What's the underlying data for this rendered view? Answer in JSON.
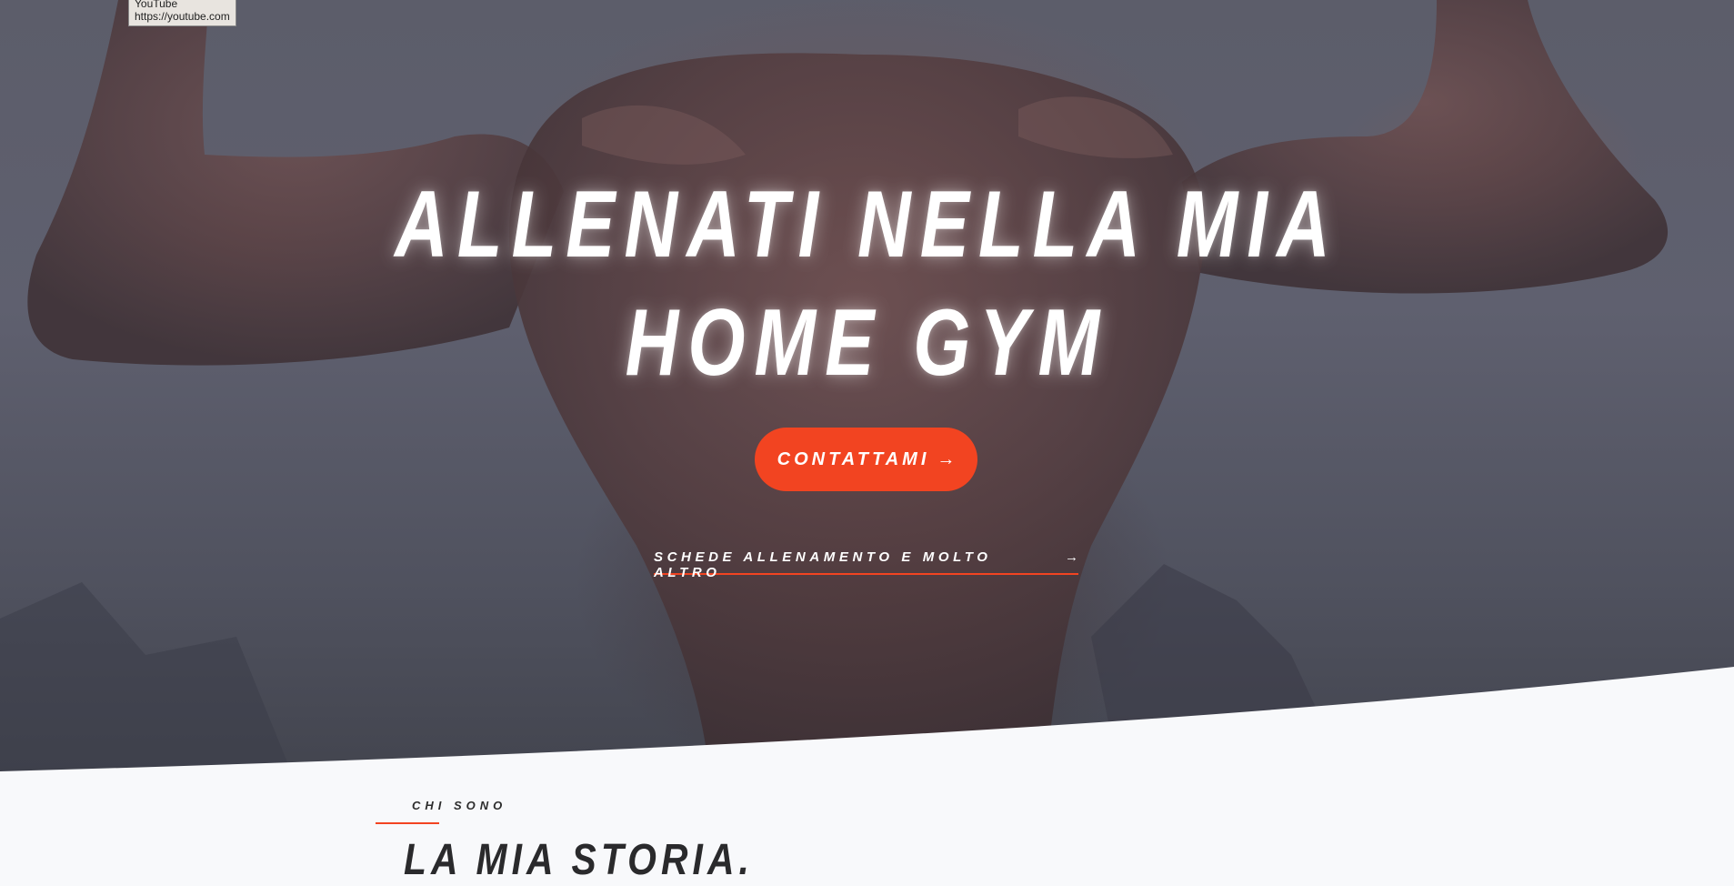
{
  "tooltip": {
    "title": "YouTube",
    "url": "https://youtube.com"
  },
  "hero": {
    "headline_line1": "ALLENATI NELLA MIA",
    "headline_line2": "HOME GYM",
    "cta_label": "CONTATTAMI",
    "cta_arrow": "→",
    "secondary_link_label": "SCHEDE ALLENAMENTO E MOLTO ALTRO",
    "secondary_link_arrow": "→"
  },
  "about": {
    "eyebrow": "CHI SONO",
    "title": "LA MIA STORIA."
  },
  "colors": {
    "accent": "#f24421",
    "hero_overlay": "#5c5d6a",
    "section_background": "#f8f9fb",
    "heading_text": "#2a2a2c"
  }
}
